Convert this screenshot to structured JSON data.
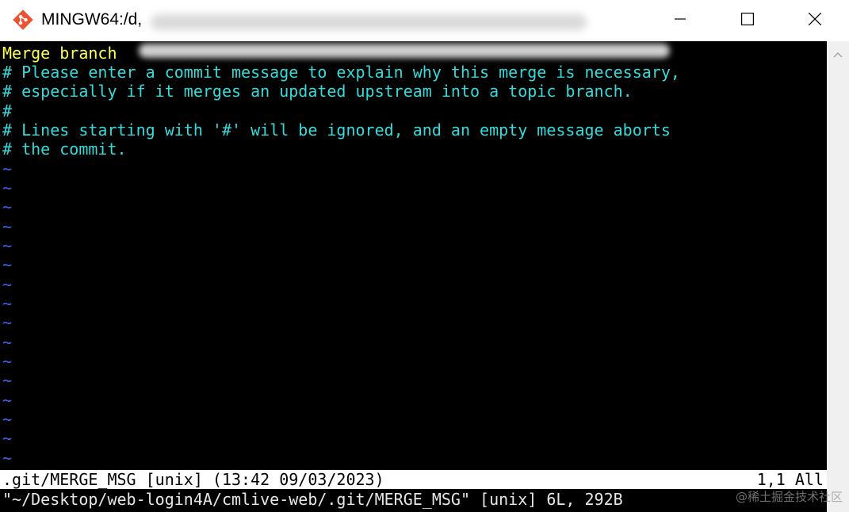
{
  "window": {
    "title": "MINGW64:/d,",
    "icon": "git-icon",
    "controls": {
      "minimize_icon": "minimize-icon",
      "maximize_icon": "maximize-icon",
      "close_icon": "close-icon"
    }
  },
  "editor": {
    "lines": [
      {
        "text": "Merge branch",
        "color": "#ffff55"
      },
      {
        "text": "# Please enter a commit message to explain why this merge is necessary,",
        "color": "#33dcdc"
      },
      {
        "text": "# especially if it merges an updated upstream into a topic branch.",
        "color": "#33dcdc"
      },
      {
        "text": "#",
        "color": "#33dcdc"
      },
      {
        "text": "# Lines starting with '#' will be ignored, and an empty message aborts",
        "color": "#33dcdc"
      },
      {
        "text": "# the commit.",
        "color": "#33dcdc"
      }
    ],
    "empty_marker": "~",
    "empty_line_count": 16,
    "status_bar": {
      "left": ".git/MERGE_MSG [unix] (13:42 09/03/2023)",
      "right": "1,1 All"
    },
    "message": "\"~/Desktop/web-login4A/cmlive-web/.git/MERGE_MSG\" [unix] 6L, 292B"
  },
  "watermark": "@稀土掘金技术社区",
  "colors": {
    "background": "#000000",
    "comment": "#33dcdc",
    "merge_line": "#ffff55",
    "tilde": "#3c64ee",
    "status_bg": "#ffffff"
  }
}
